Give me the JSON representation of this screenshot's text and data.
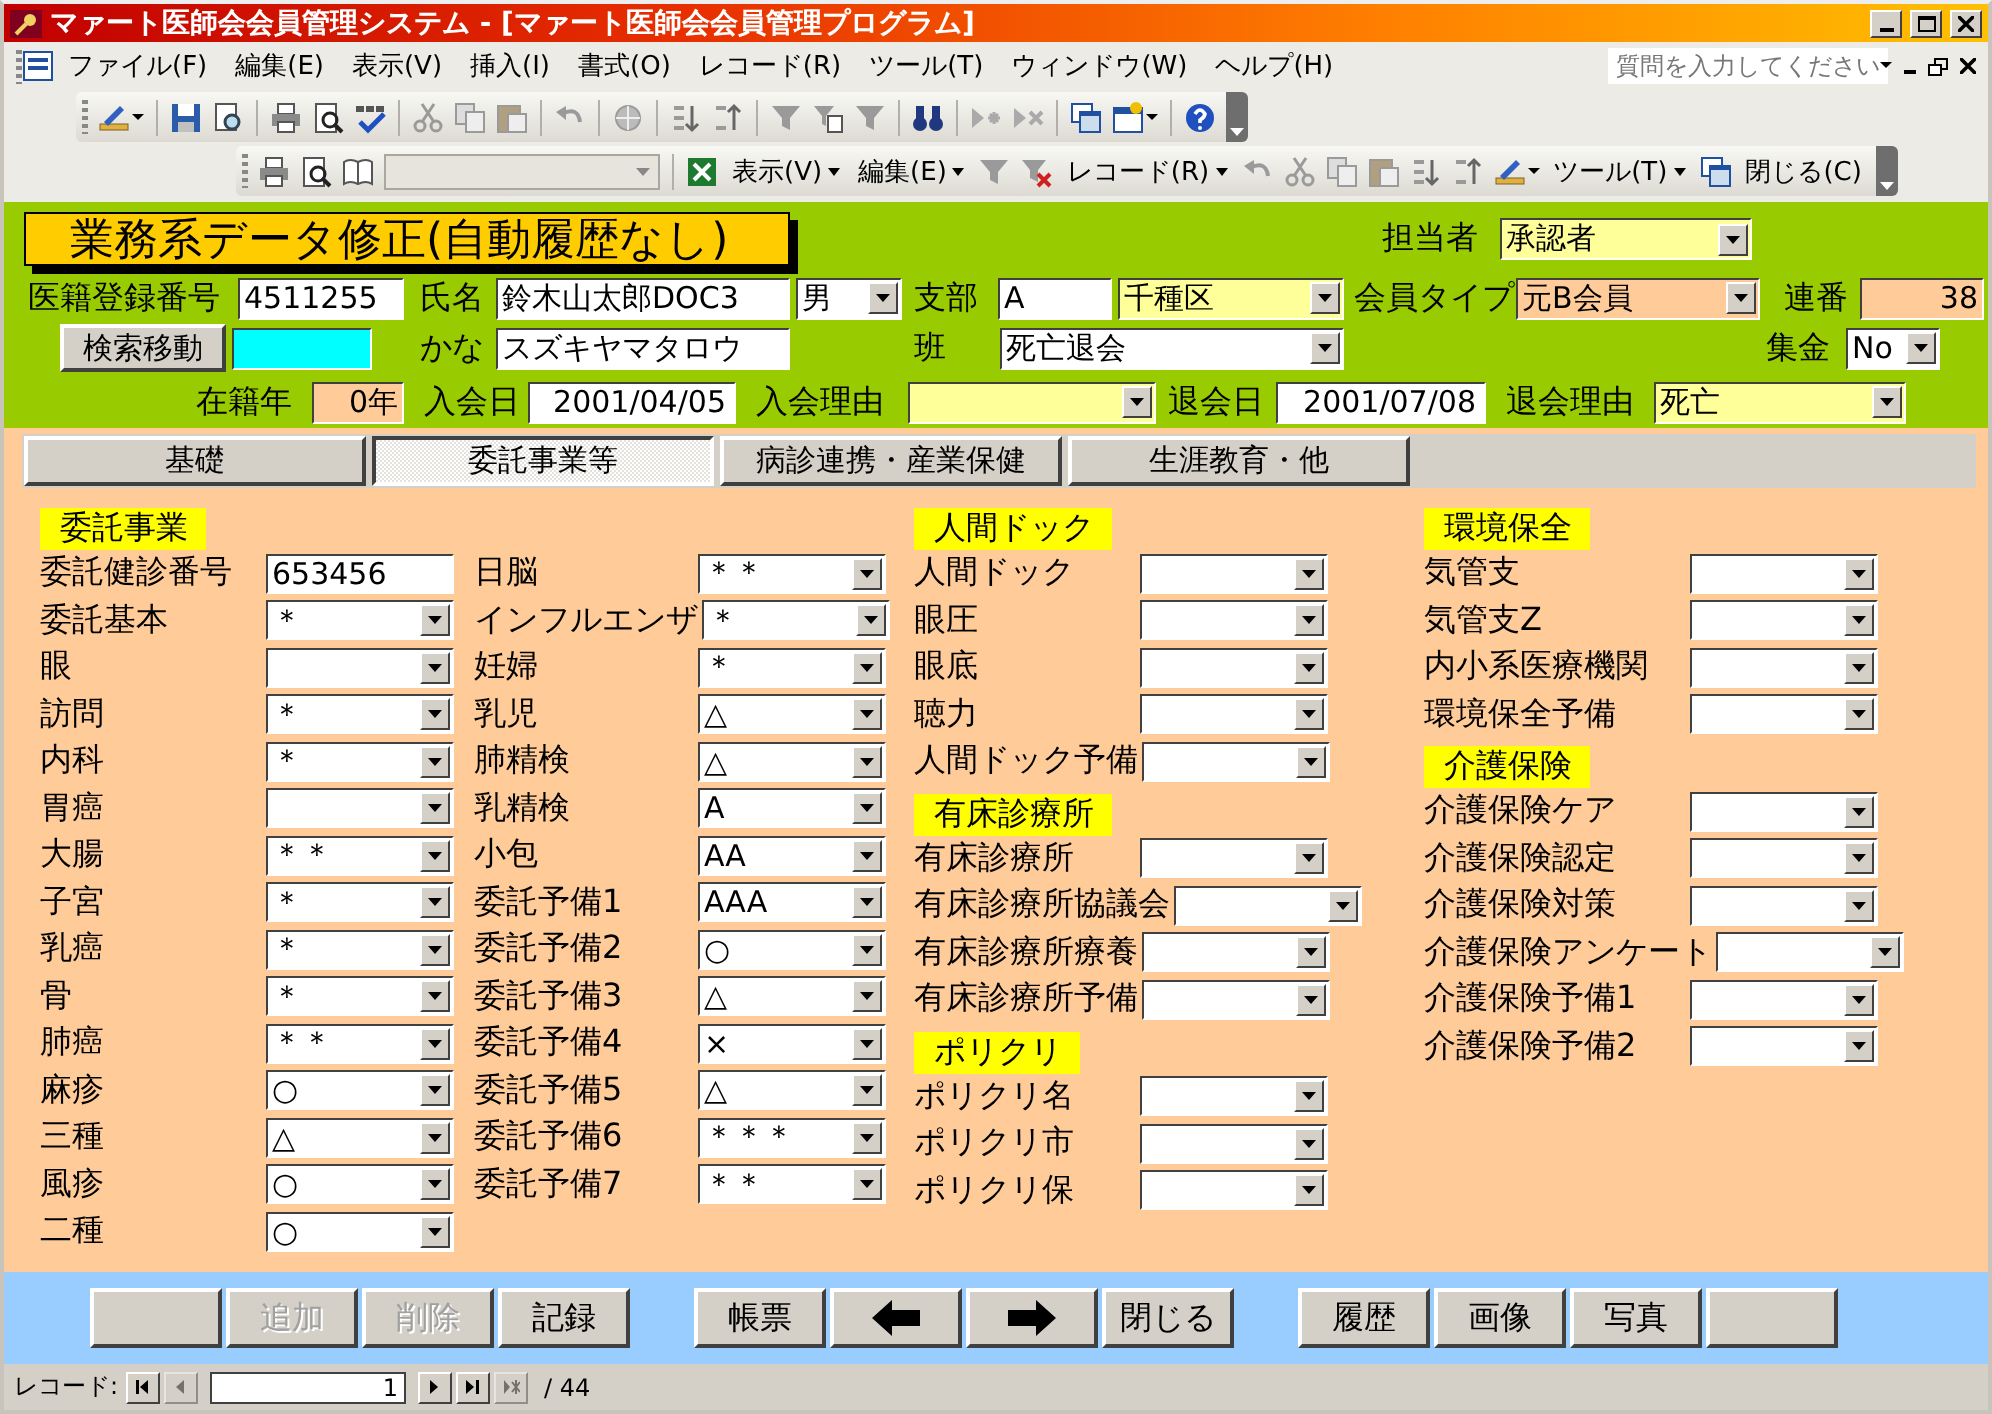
{
  "window": {
    "title": "マァート医師会会員管理システム - [マァート医師会会員管理プログラム]"
  },
  "menubar": {
    "items": [
      "ファイル(F)",
      "編集(E)",
      "表示(V)",
      "挿入(I)",
      "書式(O)",
      "レコード(R)",
      "ツール(T)",
      "ウィンドウ(W)",
      "ヘルプ(H)"
    ],
    "help": {
      "placeholder": "質問を入力してください"
    }
  },
  "toolbar": {
    "menus": [
      {
        "kind": "dropdown",
        "label": "表示(V)"
      },
      {
        "kind": "dropdown",
        "label": "編集(E)"
      },
      {
        "kind": "dropdown",
        "label": "レコード(R)"
      },
      {
        "kind": "dropdown",
        "label": "ツール(T)"
      },
      {
        "kind": "button",
        "label": "閉じる(C)"
      }
    ]
  },
  "header": {
    "title": "業務系データ修正(自動履歴なし)",
    "fields": [
      {
        "label": "担当者",
        "kind": "combo",
        "value": "承認者",
        "color": "#ffff99"
      },
      {
        "label": "医籍登録番号",
        "kind": "text",
        "value": "4511255"
      },
      {
        "label": "氏名",
        "kind": "text",
        "value": "鈴木山太郎DOC3"
      },
      {
        "kind": "combo",
        "value": "男"
      },
      {
        "label": "支部",
        "kind": "text",
        "value": "A"
      },
      {
        "kind": "combo",
        "value": "千種区",
        "color": "#ffff99"
      },
      {
        "label": "会員タイプ",
        "kind": "combo",
        "value": "元B会員",
        "color": "#ffcc99"
      },
      {
        "label": "連番",
        "kind": "number",
        "value": "38",
        "color": "#ffcc99"
      },
      {
        "kind": "button",
        "text": "検索移動"
      },
      {
        "kind": "text",
        "color": "#00ffff"
      },
      {
        "label": "かな",
        "kind": "text",
        "value": "スズキヤマタロウ"
      },
      {
        "label": "班",
        "kind": "combo",
        "value": "死亡退会"
      },
      {
        "label": "集金",
        "kind": "combo",
        "value": "No"
      },
      {
        "label": "在籍年",
        "kind": "number",
        "value": "0年",
        "color": "#ffcc99"
      },
      {
        "label": "入会日",
        "kind": "date",
        "value": "2001/04/05"
      },
      {
        "label": "入会理由",
        "kind": "combo",
        "color": "#ffff99"
      },
      {
        "label": "退会日",
        "kind": "date",
        "value": "2001/07/08"
      },
      {
        "label": "退会理由",
        "kind": "combo",
        "value": "死亡",
        "color": "#ffff99"
      }
    ]
  },
  "tabs": [
    {
      "label": "基礎",
      "selected": false
    },
    {
      "label": "委託事業等",
      "selected": true
    },
    {
      "label": "病診連携・産業保健",
      "selected": false
    },
    {
      "label": "生涯教育・他",
      "selected": false
    }
  ],
  "columns": [
    {
      "sections": [
        {
          "heading": "委託事業",
          "fields": [
            {
              "kind": "text",
              "label": "委託健診番号",
              "value": "653456"
            },
            {
              "kind": "combo",
              "label": "委託基本",
              "value": "＊"
            },
            {
              "kind": "combo",
              "label": "眼"
            },
            {
              "kind": "combo",
              "label": "訪問",
              "value": "＊"
            },
            {
              "kind": "combo",
              "label": "内科",
              "value": "＊"
            },
            {
              "kind": "combo",
              "label": "胃癌"
            },
            {
              "kind": "combo",
              "label": "大腸",
              "value": "＊＊"
            },
            {
              "kind": "combo",
              "label": "子宮",
              "value": "＊"
            },
            {
              "kind": "combo",
              "label": "乳癌",
              "value": "＊"
            },
            {
              "kind": "combo",
              "label": "骨",
              "value": "＊"
            },
            {
              "kind": "combo",
              "label": "肺癌",
              "value": "＊＊"
            },
            {
              "kind": "combo",
              "label": "麻疹",
              "value": "○"
            },
            {
              "kind": "combo",
              "label": "三種",
              "value": "△"
            },
            {
              "kind": "combo",
              "label": "風疹",
              "value": "○"
            },
            {
              "kind": "combo",
              "label": "二種",
              "value": "○"
            }
          ]
        }
      ]
    },
    {
      "sections": [
        {
          "fields": [
            {
              "kind": "combo",
              "label": "日脳",
              "value": "＊＊"
            },
            {
              "kind": "combo",
              "label": "インフルエンザ",
              "value": "＊"
            },
            {
              "kind": "combo",
              "label": "妊婦",
              "value": "＊"
            },
            {
              "kind": "combo",
              "label": "乳児",
              "value": "△"
            },
            {
              "kind": "combo",
              "label": "肺精検",
              "value": "△"
            },
            {
              "kind": "combo",
              "label": "乳精検",
              "value": "A"
            },
            {
              "kind": "combo",
              "label": "小包",
              "value": "AA"
            },
            {
              "kind": "combo",
              "label": "委託予備1",
              "value": "AAA"
            },
            {
              "kind": "combo",
              "label": "委託予備2",
              "value": "○"
            },
            {
              "kind": "combo",
              "label": "委託予備3",
              "value": "△"
            },
            {
              "kind": "combo",
              "label": "委託予備4",
              "value": "×"
            },
            {
              "kind": "combo",
              "label": "委託予備5",
              "value": "△"
            },
            {
              "kind": "combo",
              "label": "委託予備6",
              "value": "＊＊＊"
            },
            {
              "kind": "combo",
              "label": "委託予備7",
              "value": "＊＊"
            }
          ]
        }
      ]
    },
    {
      "sections": [
        {
          "heading": "人間ドック",
          "fields": [
            {
              "kind": "combo",
              "label": "人間ドック"
            },
            {
              "kind": "combo",
              "label": "眼圧"
            },
            {
              "kind": "combo",
              "label": "眼底"
            },
            {
              "kind": "combo",
              "label": "聴力"
            },
            {
              "kind": "combo",
              "label": "人間ドック予備"
            }
          ]
        },
        {
          "heading": "有床診療所",
          "fields": [
            {
              "kind": "combo",
              "label": "有床診療所"
            },
            {
              "kind": "combo",
              "label": "有床診療所協議会"
            },
            {
              "kind": "combo",
              "label": "有床診療所療養"
            },
            {
              "kind": "combo",
              "label": "有床診療所予備"
            }
          ]
        },
        {
          "heading": "ポリクリ",
          "fields": [
            {
              "kind": "combo",
              "label": "ポリクリ名"
            },
            {
              "kind": "combo",
              "label": "ポリクリ市"
            },
            {
              "kind": "combo",
              "label": "ポリクリ保"
            }
          ]
        }
      ]
    },
    {
      "sections": [
        {
          "heading": "環境保全",
          "fields": [
            {
              "kind": "combo",
              "label": "気管支"
            },
            {
              "kind": "combo",
              "label": "気管支Z"
            },
            {
              "kind": "combo",
              "label": "内小系医療機関"
            },
            {
              "kind": "combo",
              "label": "環境保全予備"
            }
          ]
        },
        {
          "heading": "介護保険",
          "fields": [
            {
              "kind": "combo",
              "label": "介護保険ケア"
            },
            {
              "kind": "combo",
              "label": "介護保険認定"
            },
            {
              "kind": "combo",
              "label": "介護保険対策"
            },
            {
              "kind": "combo",
              "label": "介護保険アンケート"
            },
            {
              "kind": "combo",
              "label": "介護保険予備1"
            },
            {
              "kind": "combo",
              "label": "介護保険予備2"
            }
          ]
        }
      ]
    }
  ],
  "buttons": [
    [
      {
        "kind": "blank"
      },
      {
        "kind": "text",
        "label": "追加",
        "disabled": true
      },
      {
        "kind": "text",
        "label": "削除",
        "disabled": true
      },
      {
        "kind": "text",
        "label": "記録",
        "disabled": false
      }
    ],
    [
      {
        "kind": "text",
        "label": "帳票",
        "disabled": false
      },
      {
        "kind": "arrow-left",
        "disabled": false
      },
      {
        "kind": "arrow-right",
        "disabled": false
      },
      {
        "kind": "text",
        "label": "閉じる",
        "disabled": false
      }
    ],
    [
      {
        "kind": "text",
        "label": "履歴",
        "disabled": false
      },
      {
        "kind": "text",
        "label": "画像",
        "disabled": false
      },
      {
        "kind": "text",
        "label": "写真",
        "disabled": false
      },
      {
        "kind": "blank"
      }
    ]
  ],
  "record_nav": {
    "label": "レコード:",
    "current": "1",
    "total": "/ 44",
    "buttons": [
      {
        "kind": "first",
        "disabled": false
      },
      {
        "kind": "prev",
        "disabled": true
      },
      {
        "kind": "next",
        "disabled": false
      },
      {
        "kind": "last",
        "disabled": false
      },
      {
        "kind": "new",
        "disabled": true
      }
    ]
  }
}
